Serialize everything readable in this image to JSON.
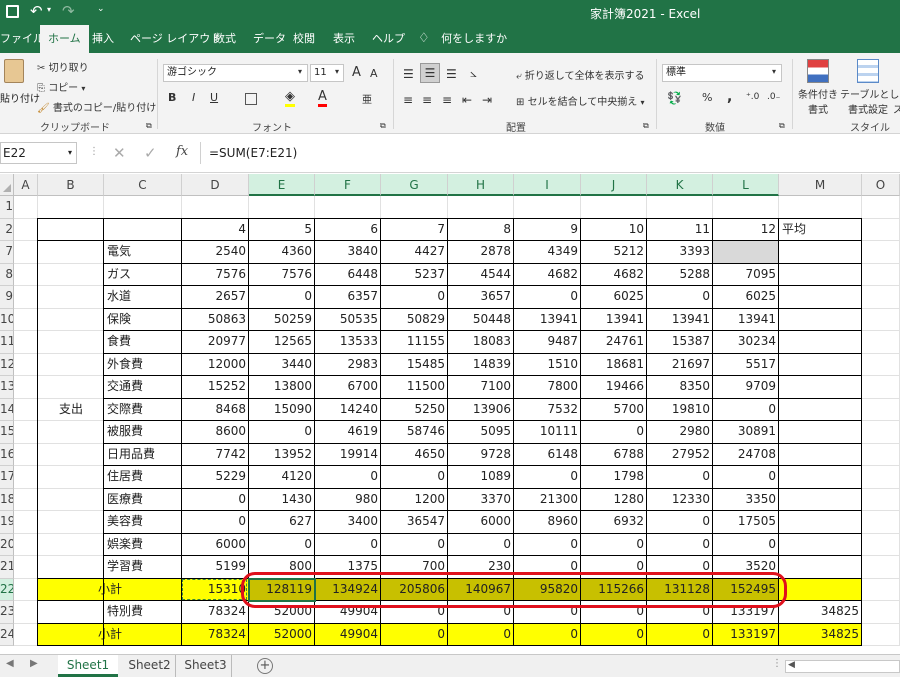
{
  "title_bar": {
    "title": "家計簿2021",
    "separator": "-",
    "app": "Excel",
    "more": "⌄"
  },
  "tabs": [
    "ファイル",
    "ホーム",
    "挿入",
    "ページ レイアウト",
    "数式",
    "データ",
    "校閲",
    "表示",
    "ヘルプ"
  ],
  "tell_me": "何をしますか",
  "ribbon": {
    "clipboard": {
      "paste": "貼り付け",
      "cut": "切り取り",
      "copy": "コピー",
      "format_painter": "書式のコピー/貼り付け",
      "label": "クリップボード"
    },
    "font": {
      "name": "游ゴシック",
      "size": "11",
      "grow": "A",
      "shrink": "A",
      "bold": "B",
      "italic": "I",
      "underline": "U",
      "font_color": "A",
      "label": "フォント"
    },
    "alignment": {
      "wrap": "折り返して全体を表示する",
      "merge": "セルを結合して中央揃え",
      "label": "配置"
    },
    "number": {
      "format": "標準",
      "percent": "%",
      "comma": ",",
      "label": "数値"
    },
    "styles": {
      "conditional_line1": "条件付き",
      "conditional_line2": "書式",
      "table_line1": "テーブルとして",
      "table_line2": "書式設定",
      "cell_styles": "ス",
      "label": "スタイル"
    }
  },
  "formula_bar": {
    "name_box": "E22",
    "fx": "fx",
    "formula": "=SUM(E7:E21)"
  },
  "columns": [
    "A",
    "B",
    "C",
    "D",
    "E",
    "F",
    "G",
    "H",
    "I",
    "J",
    "K",
    "L",
    "M",
    "O"
  ],
  "row_numbers": [
    "1",
    "2",
    "7",
    "8",
    "9",
    "10",
    "11",
    "12",
    "13",
    "14",
    "15",
    "16",
    "17",
    "18",
    "19",
    "20",
    "21",
    "22",
    "23",
    "24"
  ],
  "header_row": {
    "months": [
      "4",
      "5",
      "6",
      "7",
      "8",
      "9",
      "10",
      "11",
      "12"
    ],
    "avg": "平均"
  },
  "expense_group": "支出",
  "expenses": [
    {
      "name": "電気",
      "values": [
        "2540",
        "4360",
        "3840",
        "4427",
        "2878",
        "4349",
        "5212",
        "3393",
        ""
      ]
    },
    {
      "name": "ガス",
      "values": [
        "7576",
        "7576",
        "6448",
        "5237",
        "4544",
        "4682",
        "4682",
        "5288",
        "7095"
      ]
    },
    {
      "name": "水道",
      "values": [
        "2657",
        "0",
        "6357",
        "0",
        "3657",
        "0",
        "6025",
        "0",
        "6025"
      ]
    },
    {
      "name": "保険",
      "values": [
        "50863",
        "50259",
        "50535",
        "50829",
        "50448",
        "13941",
        "13941",
        "13941",
        "13941"
      ]
    },
    {
      "name": "食費",
      "values": [
        "20977",
        "12565",
        "13533",
        "11155",
        "18083",
        "9487",
        "24761",
        "15387",
        "30234"
      ]
    },
    {
      "name": "外食費",
      "values": [
        "12000",
        "3440",
        "2983",
        "15485",
        "14839",
        "1510",
        "18681",
        "21697",
        "5517"
      ]
    },
    {
      "name": "交通費",
      "values": [
        "15252",
        "13800",
        "6700",
        "11500",
        "7100",
        "7800",
        "19466",
        "8350",
        "9709"
      ]
    },
    {
      "name": "交際費",
      "values": [
        "8468",
        "15090",
        "14240",
        "5250",
        "13906",
        "7532",
        "5700",
        "19810",
        "0"
      ]
    },
    {
      "name": "被服費",
      "values": [
        "8600",
        "0",
        "4619",
        "58746",
        "5095",
        "10111",
        "0",
        "2980",
        "30891"
      ]
    },
    {
      "name": "日用品費",
      "values": [
        "7742",
        "13952",
        "19914",
        "4650",
        "9728",
        "6148",
        "6788",
        "27952",
        "24708"
      ]
    },
    {
      "name": "住居費",
      "values": [
        "5229",
        "4120",
        "0",
        "0",
        "1089",
        "0",
        "1798",
        "0",
        "0"
      ]
    },
    {
      "name": "医療費",
      "values": [
        "0",
        "1430",
        "980",
        "1200",
        "3370",
        "21300",
        "1280",
        "12330",
        "3350"
      ]
    },
    {
      "name": "美容費",
      "values": [
        "0",
        "627",
        "3400",
        "36547",
        "6000",
        "8960",
        "6932",
        "0",
        "17505"
      ]
    },
    {
      "name": "娯楽費",
      "values": [
        "6000",
        "0",
        "0",
        "0",
        "0",
        "0",
        "0",
        "0",
        "0"
      ]
    },
    {
      "name": "学習費",
      "values": [
        "5199",
        "800",
        "1375",
        "700",
        "230",
        "0",
        "0",
        "0",
        "3520"
      ]
    }
  ],
  "subtotal1": {
    "label": "小計",
    "values": [
      "15310",
      "128119",
      "134924",
      "205806",
      "140967",
      "95820",
      "115266",
      "131128",
      "152495"
    ]
  },
  "special": {
    "label": "特別費",
    "values": [
      "78324",
      "52000",
      "49904",
      "0",
      "0",
      "0",
      "0",
      "0",
      "133197"
    ],
    "avg": "34825"
  },
  "subtotal2": {
    "label": "小計",
    "values": [
      "78324",
      "52000",
      "49904",
      "0",
      "0",
      "0",
      "0",
      "0",
      "133197"
    ],
    "avg": "34825"
  },
  "sheets": [
    "Sheet1",
    "Sheet2",
    "Sheet3"
  ],
  "add_sheet": "+",
  "colors": {
    "excel_green": "#217346",
    "highlight_yellow": "#ffff00",
    "selection_fill": "#c8c000",
    "annotation_red": "#e0101c"
  }
}
